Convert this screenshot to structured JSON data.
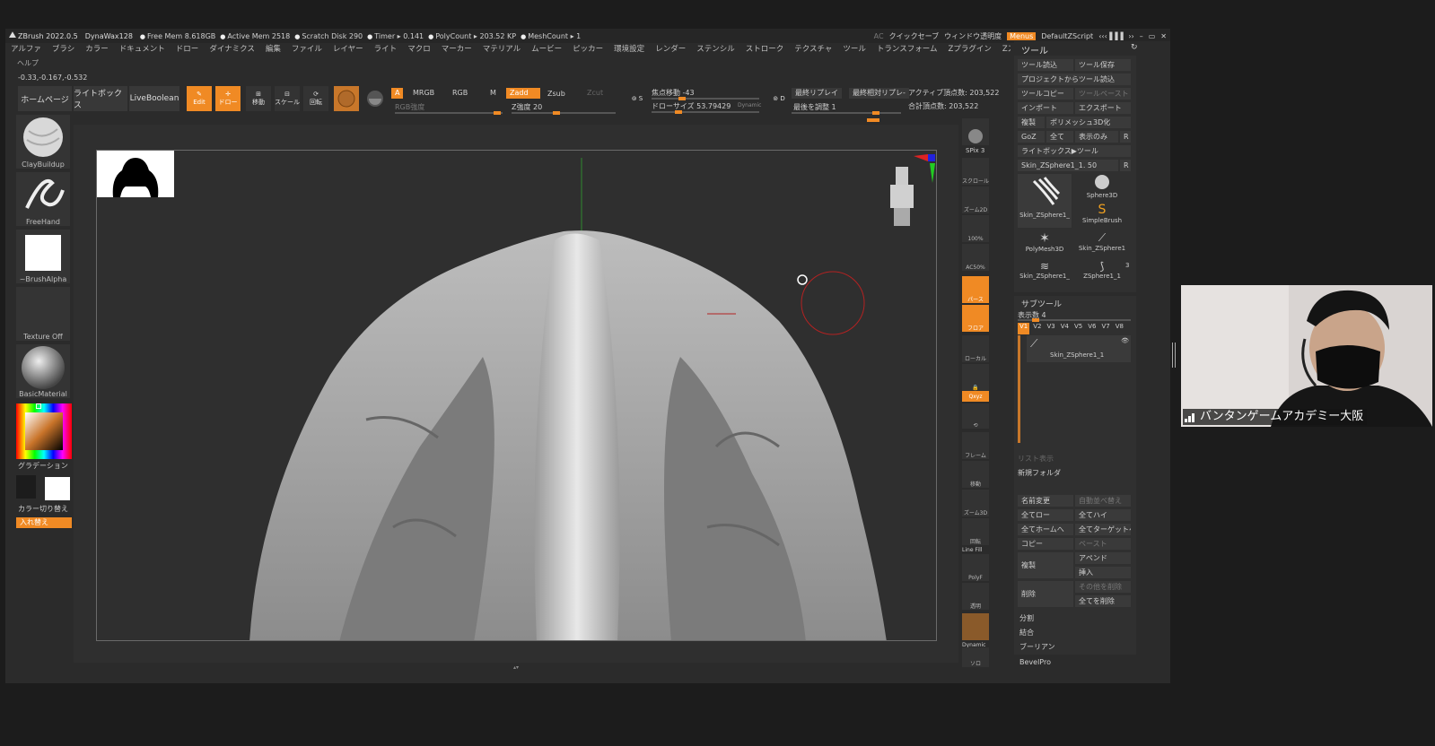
{
  "titlebar": {
    "app": "ZBrush 2022.0.5",
    "brush": "DynaWax128",
    "stats": [
      "Free Mem 8.618GB",
      "Active Mem 2518",
      "Scratch Disk 290",
      "Timer ▸ 0.141",
      "PolyCount ▸ 203.52 KP",
      "MeshCount ▸ 1"
    ],
    "ac": "AC",
    "quicksave": "クイックセーブ",
    "transparency": "ウィンドウ透明度",
    "menus": "Menus",
    "script": "DefaultZScript",
    "min": "–",
    "max": "▭",
    "close": "✕"
  },
  "menubar": [
    "アルファ",
    "ブラシ",
    "カラー",
    "ドキュメント",
    "ドロー",
    "ダイナミクス",
    "編集",
    "ファイル",
    "レイヤー",
    "ライト",
    "マクロ",
    "マーカー",
    "マテリアル",
    "ムービー",
    "ピッカー",
    "環境設定",
    "レンダー",
    "ステンシル",
    "ストローク",
    "テクスチャ",
    "ツール",
    "トランスフォーム",
    "Zプラグイン",
    "Zスクリプト"
  ],
  "help": "ヘルプ",
  "coords": "-0.33,-0.167,-0.532",
  "toolbar": {
    "home": "ホームページ",
    "lightbox": "ライトボックス",
    "liveboolean": "LiveBoolean",
    "edit": "Edit",
    "draw": "ドロー",
    "move": "移動",
    "scale": "スケール",
    "rotate": "回転",
    "a": "A",
    "mrgb": "MRGB",
    "rgb": "RGB",
    "m": "M",
    "zadd": "Zadd",
    "zsub": "Zsub",
    "zcut": "Zcut",
    "rgb_intensity": "RGB強度",
    "z_intensity": "Z強度 20",
    "focal": "焦点移動 -43",
    "drawsize": "ドローサイズ 53.79429",
    "dynamic": "Dynamic",
    "replay": "最終リプレイ",
    "replay_rel": "最終相対リプレ-",
    "adjust": "最後を調整 1",
    "active_points": "アクティブ頂点数: 203,522",
    "total_points": "合計頂点数: 203,522"
  },
  "leftshelf": {
    "brush": "ClayBuildup",
    "stroke": "FreeHand",
    "alpha": "~BrushAlpha",
    "texture": "Texture Off",
    "material": "BasicMaterial",
    "gradient": "グラデーション",
    "switch_color": "カラー切り替え",
    "swap": "入れ替え"
  },
  "rightstrip": {
    "spix": "SPix 3",
    "scroll": "スクロール",
    "zoom": "ズーム2D",
    "zoom100": "100%",
    "ac50": "AC50%",
    "perspective": "パース",
    "floor": "フロア",
    "local": "ローカル",
    "xyz": "Qxyz",
    "frame": "フレーム",
    "move": "移動",
    "zoom3d": "ズーム3D",
    "rotate": "回転",
    "linefill": "Line Fill",
    "polyf": "PolyF",
    "transp": "透明",
    "dynamic": "Dynamic",
    "solo": "ソロ"
  },
  "toolpanel": {
    "title": "ツール",
    "load": "ツール読込",
    "save": "ツール保存",
    "from_project": "プロジェクトからツール読込",
    "copy": "ツールコピー",
    "paste": "ツールペースト",
    "import": "インポート",
    "export": "エクスポート",
    "clone": "複製",
    "polymesh3d": "ポリメッシュ3D化",
    "goz": "GoZ",
    "all": "全て",
    "visible": "表示のみ",
    "r": "R",
    "lightbox_tools": "ライトボックス▶ツール",
    "current_tool": "Skin_ZSphere1_1. 50",
    "tools": [
      {
        "label": "Skin_ZSphere1_"
      },
      {
        "label": "Sphere3D"
      },
      {
        "label": "SimpleBrush"
      },
      {
        "label": "PolyMesh3D"
      },
      {
        "label": "Skin_ZSphere1"
      },
      {
        "label": "Skin_ZSphere1_"
      },
      {
        "label": "ZSphere1_1"
      }
    ],
    "tool_count": "3",
    "subtool": "サブツール",
    "visible_count": "表示数 4",
    "versions": [
      "V1",
      "V2",
      "V3",
      "V4",
      "V5",
      "V6",
      "V7",
      "V8"
    ],
    "subtool_name": "Skin_ZSphere1_1",
    "list_view": "リスト表示",
    "new_folder": "新規フォルダ",
    "rename": "名前変更",
    "auto_reorder": "自動並べ替え",
    "all_low": "全てロー",
    "all_high": "全てハイ",
    "all_home": "全てホームへ",
    "all_target": "全てターゲットへ",
    "copy2": "コピー",
    "paste2": "ペースト",
    "duplicate": "複製",
    "append": "アペンド",
    "insert": "挿入",
    "delete": "削除",
    "delete_other": "その他を削除",
    "delete_all": "全てを削除",
    "split": "分割",
    "merge": "結合",
    "boolean": "ブーリアン",
    "bevelpro": "BevelPro"
  },
  "video": {
    "name": "バンタンゲームアカデミー大阪"
  },
  "colors": {
    "accent": "#f08a24",
    "panel": "#2b2b2b",
    "canvas": "#2f2f2f"
  }
}
